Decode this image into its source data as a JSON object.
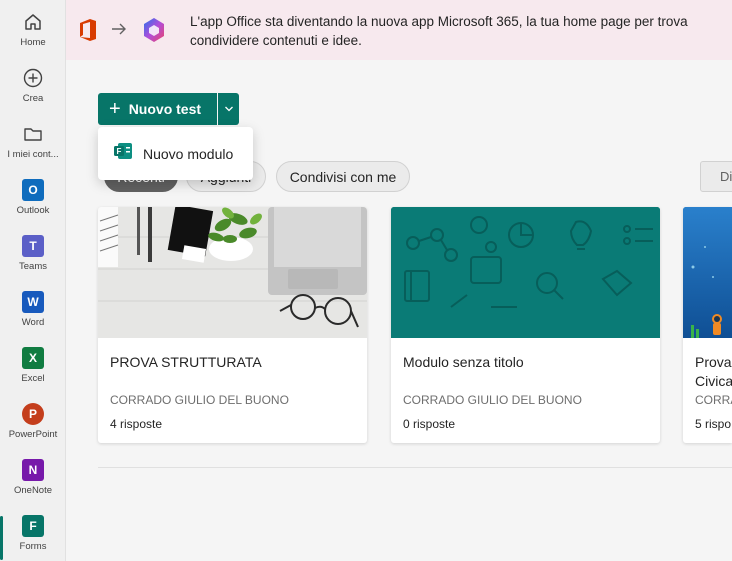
{
  "rail": {
    "items": [
      {
        "label": "Home",
        "icon": "home-icon"
      },
      {
        "label": "Crea",
        "icon": "create-icon"
      },
      {
        "label": "I miei cont...",
        "icon": "folder-icon"
      },
      {
        "label": "Outlook",
        "icon": "outlook-icon",
        "letter": "O",
        "color": "#0f6cbd"
      },
      {
        "label": "Teams",
        "icon": "teams-icon",
        "letter": "T",
        "color": "#5b5fc7"
      },
      {
        "label": "Word",
        "icon": "word-icon",
        "letter": "W",
        "color": "#185abd"
      },
      {
        "label": "Excel",
        "icon": "excel-icon",
        "letter": "X",
        "color": "#107c41"
      },
      {
        "label": "PowerPoint",
        "icon": "powerpoint-icon",
        "letter": "P",
        "color": "#c43e1c"
      },
      {
        "label": "OneNote",
        "icon": "onenote-icon",
        "letter": "N",
        "color": "#7719aa"
      },
      {
        "label": "Forms",
        "icon": "forms-icon",
        "letter": "F",
        "color": "#077568"
      }
    ],
    "active": "Forms"
  },
  "banner": {
    "text_line1": "L'app Office sta diventando la nuova app Microsoft 365, la tua home page per trova",
    "text_line2": "condividere contenuti e idee."
  },
  "toolbar": {
    "new_label": "Nuovo test",
    "new_plus": "+",
    "menu_item": "Nuovo modulo"
  },
  "filters": {
    "recent": "Recenti",
    "added": "Aggiunti",
    "shared": "Condivisi con me",
    "view_partial": "Di"
  },
  "cards": [
    {
      "title": "PROVA STRUTTURATA",
      "author": "CORRADO GIULIO DEL BUONO",
      "responses": "4 risposte"
    },
    {
      "title": "Modulo senza titolo",
      "author": "CORRADO GIULIO DEL BUONO",
      "responses": "0 risposte"
    },
    {
      "title": "Prova Civica",
      "author": "CORRA",
      "responses": "5 rispo"
    }
  ],
  "colors": {
    "accent": "#077568",
    "banner_bg": "#f7e9ee",
    "teal_thumb": "#0a7b76"
  }
}
